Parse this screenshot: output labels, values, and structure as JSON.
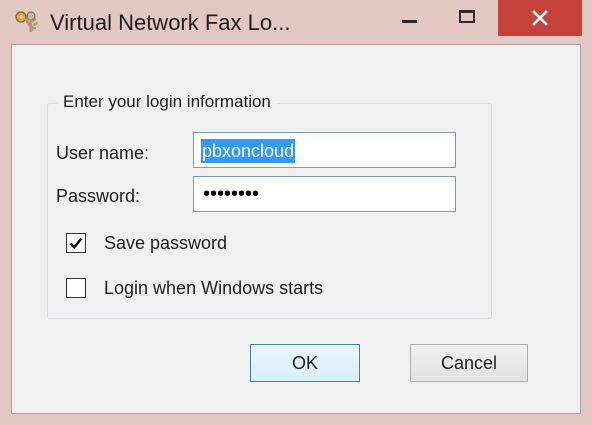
{
  "window": {
    "title": "Virtual Network Fax Lo...",
    "app_icon": "keys-icon",
    "controls": {
      "minimize_icon": "minimize-icon",
      "maximize_icon": "maximize-icon",
      "close_icon": "close-icon"
    }
  },
  "login_group": {
    "legend": "Enter your login information",
    "username": {
      "label": "User name:",
      "value": "pbxoncloud"
    },
    "password": {
      "label": "Password:",
      "masked_value": "••••••••"
    },
    "save_password": {
      "label": "Save password",
      "checked": true
    },
    "login_on_start": {
      "label": "Login when Windows starts",
      "checked": false
    }
  },
  "buttons": {
    "ok": "OK",
    "cancel": "Cancel"
  },
  "colors": {
    "titlebar": "#e3c7c2",
    "close_button": "#c4423a",
    "selection": "#3399ff",
    "dialog_bg": "#f0f0f0"
  }
}
